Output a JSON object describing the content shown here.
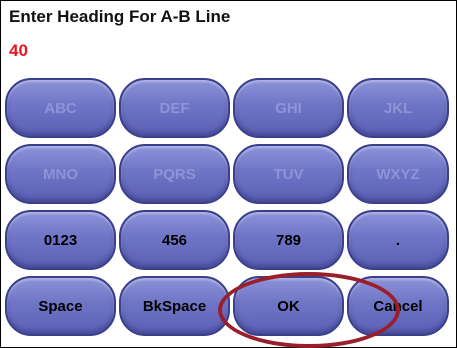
{
  "header": {
    "title": "Enter Heading For A-B Line",
    "value": "40"
  },
  "keypad": {
    "rows": [
      [
        "ABC",
        "DEF",
        "GHI",
        "JKL"
      ],
      [
        "MNO",
        "PQRS",
        "TUV",
        "WXYZ"
      ],
      [
        "0123",
        "456",
        "789",
        "."
      ],
      [
        "Space",
        "BkSpace",
        "OK",
        "Cancel"
      ]
    ]
  },
  "colors": {
    "value_text": "#e8141e",
    "key_fill": "#6f75c6",
    "key_border": "#3a3f8c",
    "disabled_text": "#8f94d8",
    "highlight_ring": "#9a1f2a"
  }
}
